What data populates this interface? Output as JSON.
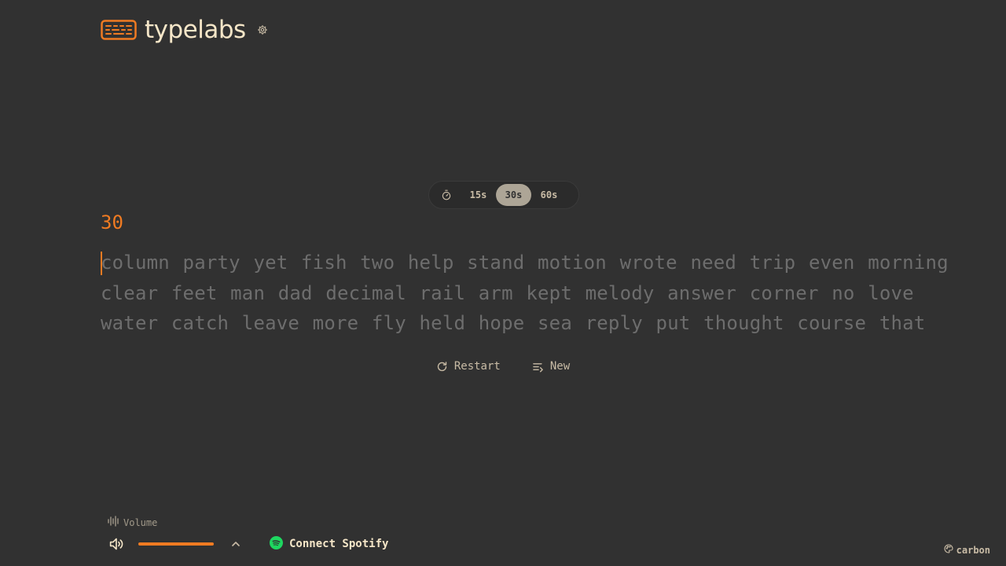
{
  "header": {
    "brand": "typelabs",
    "logo_icon": "keyboard-icon",
    "settings_icon": "gear-icon"
  },
  "time_selector": {
    "icon": "stopwatch-icon",
    "options": [
      "15s",
      "30s",
      "60s"
    ],
    "selected": "30s"
  },
  "test": {
    "countdown": "30",
    "lines": [
      "column party yet fish two help stand motion wrote need trip even morning",
      "clear feet man dad decimal rail arm kept melody answer corner no love",
      "water catch leave more fly held hope sea reply put thought course that"
    ]
  },
  "actions": {
    "restart_label": "Restart",
    "restart_icon": "refresh-icon",
    "new_label": "New",
    "new_icon": "list-icon"
  },
  "audio": {
    "volume_label": "Volume",
    "volume_label_icon": "waveform-icon",
    "speaker_icon": "speaker-icon",
    "volume_level": 1.0,
    "chevron_icon": "chevron-up-icon",
    "spotify_label": "Connect Spotify",
    "spotify_icon": "spotify-icon"
  },
  "theme": {
    "label": "carbon",
    "icon": "palette-icon"
  },
  "colors": {
    "background": "#313131",
    "accent": "#f07b22",
    "text": "#f5e6c8",
    "untyped": "#6d6d6d",
    "spotify": "#1ed760"
  }
}
